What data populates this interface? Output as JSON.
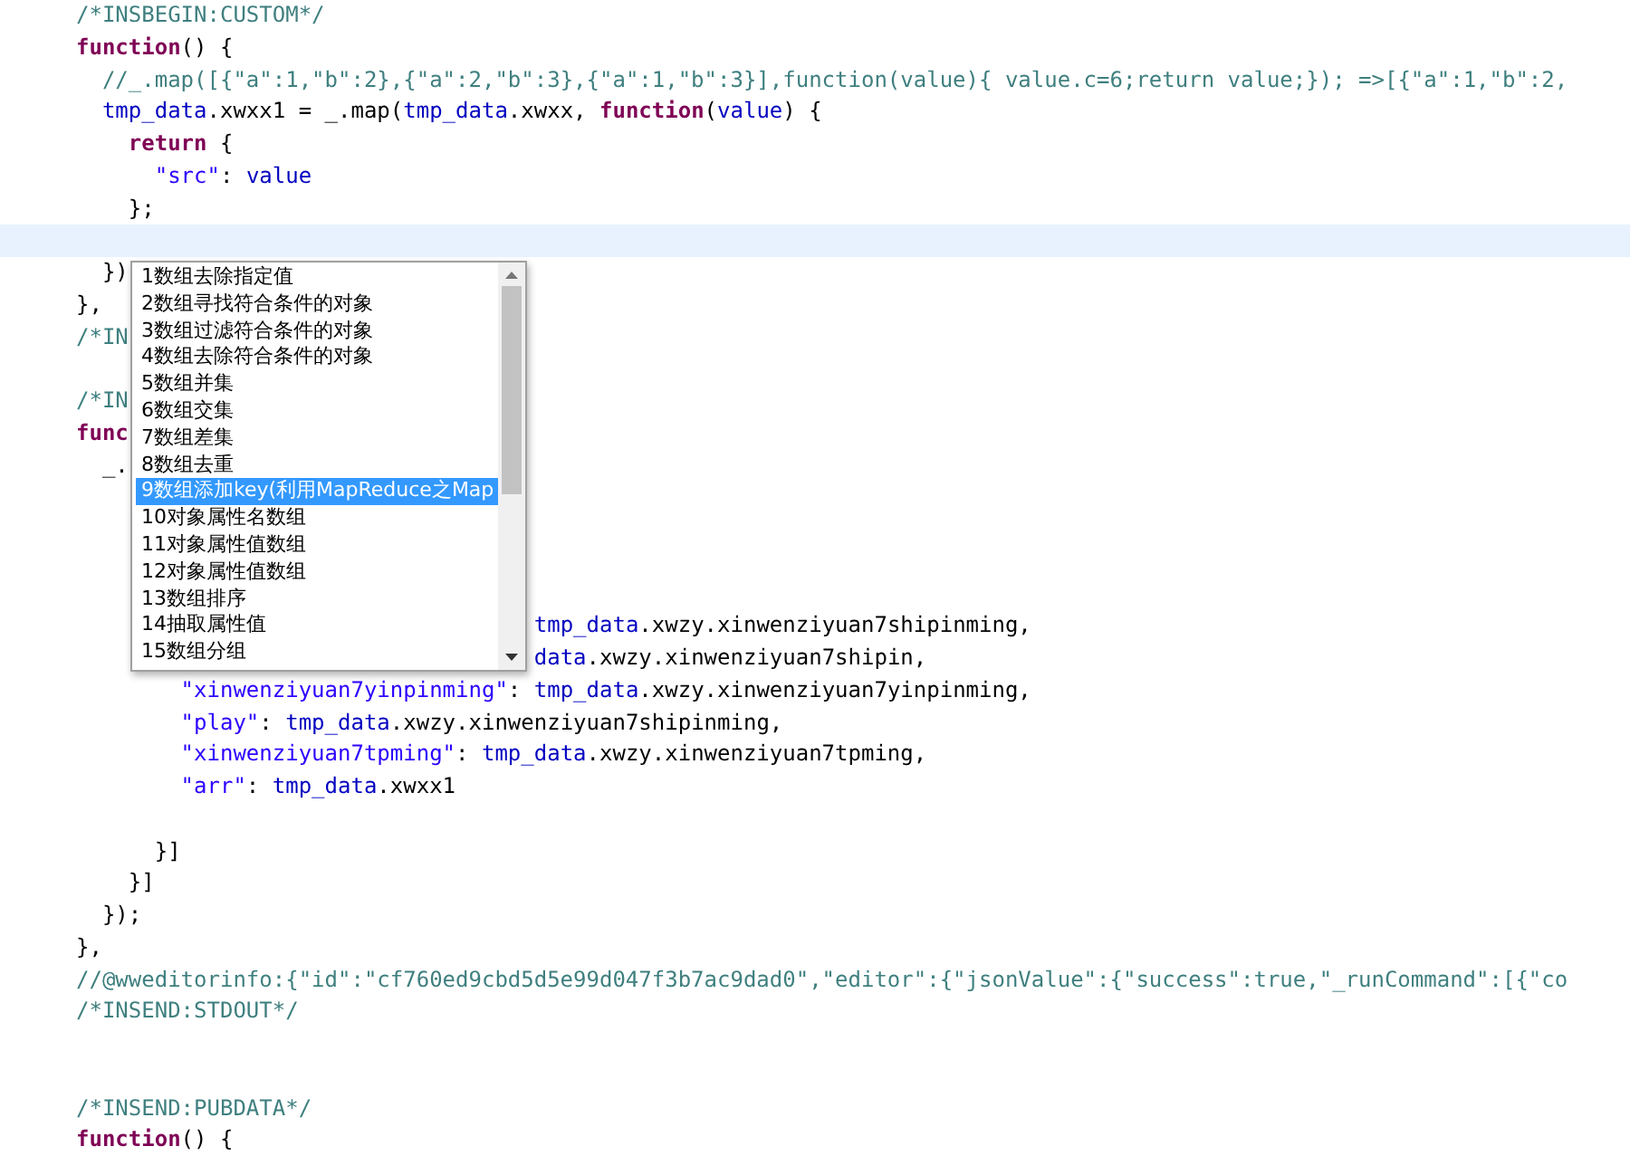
{
  "editor": {
    "lines": [
      {
        "current": false,
        "tokens": [
          {
            "kind": "comment",
            "text": "/*INSBEGIN:CUSTOM*/"
          }
        ]
      },
      {
        "current": false,
        "tokens": [
          {
            "kind": "keyword",
            "text": "function"
          },
          {
            "kind": "plain",
            "text": "() {"
          }
        ]
      },
      {
        "current": false,
        "tokens": [
          {
            "kind": "comment",
            "text": "  //_.map([{\"a\":1,\"b\":2},{\"a\":2,\"b\":3},{\"a\":1,\"b\":3}],function(value){ value.c=6;return value;}); =>[{\"a\":1,\"b\":2,"
          }
        ]
      },
      {
        "current": false,
        "tokens": [
          {
            "kind": "variable",
            "text": "  tmp_data"
          },
          {
            "kind": "plain",
            "text": ".xwxx1 = _.map("
          },
          {
            "kind": "variable",
            "text": "tmp_data"
          },
          {
            "kind": "plain",
            "text": ".xwxx, "
          },
          {
            "kind": "keyword",
            "text": "function"
          },
          {
            "kind": "plain",
            "text": "("
          },
          {
            "kind": "variable",
            "text": "value"
          },
          {
            "kind": "plain",
            "text": ") {"
          }
        ]
      },
      {
        "current": false,
        "tokens": [
          {
            "kind": "keyword",
            "text": "    return"
          },
          {
            "kind": "plain",
            "text": " {"
          }
        ]
      },
      {
        "current": false,
        "tokens": [
          {
            "kind": "string",
            "text": "      \"src\""
          },
          {
            "kind": "plain",
            "text": ": "
          },
          {
            "kind": "variable",
            "text": "value"
          }
        ]
      },
      {
        "current": false,
        "tokens": [
          {
            "kind": "plain",
            "text": "    };"
          }
        ]
      },
      {
        "current": true
      },
      {
        "current": false,
        "tokens": [
          {
            "kind": "plain",
            "text": "  })"
          }
        ]
      },
      {
        "current": false,
        "tokens": [
          {
            "kind": "plain",
            "text": "},"
          }
        ]
      },
      {
        "current": false,
        "tokens": [
          {
            "kind": "comment",
            "text": "/*IN"
          }
        ]
      },
      {
        "current": false
      },
      {
        "current": false,
        "tokens": [
          {
            "kind": "comment",
            "text": "/*IN"
          }
        ]
      },
      {
        "current": false,
        "tokens": [
          {
            "kind": "keyword",
            "text": "func"
          }
        ]
      },
      {
        "current": false,
        "tokens": [
          {
            "kind": "plain",
            "text": "  _."
          }
        ]
      },
      {
        "current": false
      },
      {
        "current": false
      },
      {
        "current": false
      },
      {
        "current": false
      },
      {
        "current": false,
        "tokens": [
          {
            "kind": "variable",
            "text": "                                   tmp_data"
          },
          {
            "kind": "plain",
            "text": ".xwzy.xinwenziyuan7shipinming,"
          }
        ]
      },
      {
        "current": false,
        "tokens": [
          {
            "kind": "variable",
            "text": "                                   data"
          },
          {
            "kind": "plain",
            "text": ".xwzy.xinwenziyuan7shipin,"
          }
        ]
      },
      {
        "current": false,
        "tokens": [
          {
            "kind": "string",
            "text": "        \"xinwenziyuan7yinpinming\""
          },
          {
            "kind": "plain",
            "text": ": "
          },
          {
            "kind": "variable",
            "text": "tmp_data"
          },
          {
            "kind": "plain",
            "text": ".xwzy.xinwenziyuan7yinpinming,"
          }
        ]
      },
      {
        "current": false,
        "tokens": [
          {
            "kind": "string",
            "text": "        \"play\""
          },
          {
            "kind": "plain",
            "text": ": "
          },
          {
            "kind": "variable",
            "text": "tmp_data"
          },
          {
            "kind": "plain",
            "text": ".xwzy.xinwenziyuan7shipinming,"
          }
        ]
      },
      {
        "current": false,
        "tokens": [
          {
            "kind": "string",
            "text": "        \"xinwenziyuan7tpming\""
          },
          {
            "kind": "plain",
            "text": ": "
          },
          {
            "kind": "variable",
            "text": "tmp_data"
          },
          {
            "kind": "plain",
            "text": ".xwzy.xinwenziyuan7tpming,"
          }
        ]
      },
      {
        "current": false,
        "tokens": [
          {
            "kind": "string",
            "text": "        \"arr\""
          },
          {
            "kind": "plain",
            "text": ": "
          },
          {
            "kind": "variable",
            "text": "tmp_data"
          },
          {
            "kind": "plain",
            "text": ".xwxx1"
          }
        ]
      },
      {
        "current": false
      },
      {
        "current": false,
        "tokens": [
          {
            "kind": "plain",
            "text": "      }]"
          }
        ]
      },
      {
        "current": false,
        "tokens": [
          {
            "kind": "plain",
            "text": "    }]"
          }
        ]
      },
      {
        "current": false,
        "tokens": [
          {
            "kind": "plain",
            "text": "  });"
          }
        ]
      },
      {
        "current": false,
        "tokens": [
          {
            "kind": "plain",
            "text": "},"
          }
        ]
      },
      {
        "current": false,
        "tokens": [
          {
            "kind": "comment",
            "text": "//@wweditorinfo:{\"id\":\"cf760ed9cbd5d5e99d047f3b7ac9dad0\",\"editor\":{\"jsonValue\":{\"success\":true,\"_runCommand\":[{\"co"
          }
        ]
      },
      {
        "current": false,
        "tokens": [
          {
            "kind": "comment",
            "text": "/*INSEND:STDOUT*/"
          }
        ]
      },
      {
        "current": false
      },
      {
        "current": false
      },
      {
        "current": false,
        "tokens": [
          {
            "kind": "comment",
            "text": "/*INSEND:PUBDATA*/"
          }
        ]
      },
      {
        "current": false,
        "tokens": [
          {
            "kind": "keyword",
            "text": "function"
          },
          {
            "kind": "plain",
            "text": "() {"
          }
        ]
      }
    ]
  },
  "completion": {
    "items": [
      {
        "label": "1数组去除指定值",
        "selected": false
      },
      {
        "label": "2数组寻找符合条件的对象",
        "selected": false
      },
      {
        "label": "3数组过滤符合条件的对象",
        "selected": false
      },
      {
        "label": "4数组去除符合条件的对象",
        "selected": false
      },
      {
        "label": "5数组并集",
        "selected": false
      },
      {
        "label": "6数组交集",
        "selected": false
      },
      {
        "label": "7数组差集",
        "selected": false
      },
      {
        "label": "8数组去重",
        "selected": false
      },
      {
        "label": "9数组添加key(利用MapReduce之Map",
        "selected": true
      },
      {
        "label": "10对象属性名数组",
        "selected": false
      },
      {
        "label": "11对象属性值数组",
        "selected": false
      },
      {
        "label": "12对象属性值数组",
        "selected": false
      },
      {
        "label": "13数组排序",
        "selected": false
      },
      {
        "label": "14抽取属性值",
        "selected": false
      },
      {
        "label": "15数组分组",
        "selected": false
      }
    ]
  }
}
